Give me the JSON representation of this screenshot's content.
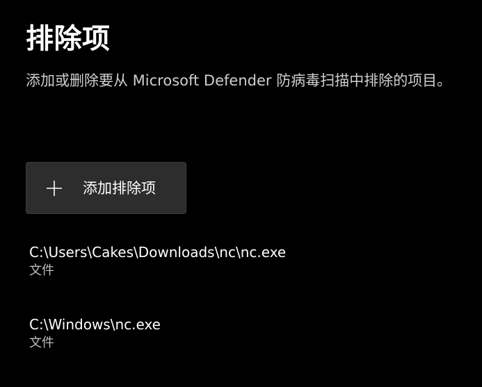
{
  "header": {
    "title": "排除项",
    "description": "添加或删除要从 Microsoft Defender 防病毒扫描中排除的项目。"
  },
  "add_button": {
    "icon": "plus-icon",
    "label": "添加排除项"
  },
  "exclusions": [
    {
      "path": "C:\\Users\\Cakes\\Downloads\\nc\\nc.exe",
      "type": "文件"
    },
    {
      "path": "C:\\Windows\\nc.exe",
      "type": "文件"
    }
  ],
  "colors": {
    "background": "#000000",
    "button_background": "#2d2d2d",
    "primary_text": "#ffffff",
    "secondary_text": "#bdbdbd"
  }
}
